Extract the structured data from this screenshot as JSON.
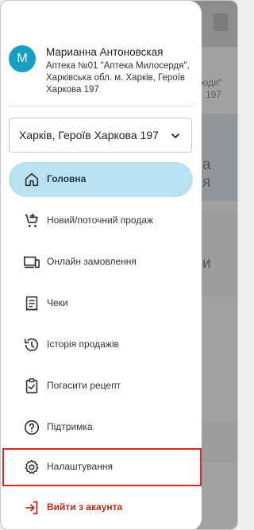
{
  "background": {
    "text_lines": [
      "родя\"",
      "197"
    ],
    "big_letters": [
      "а",
      "я",
      "и"
    ]
  },
  "user": {
    "avatar_letter": "M",
    "name": "Марианна Антоновская",
    "pharmacy": "Аптека  №01  \"Аптека Милосердя\", Харківська обл. м. Харків, Героїв Харкова 197"
  },
  "store_selector": {
    "value": "Харків, Героїв Харкова 197",
    "icon": "chevron-down-icon"
  },
  "menu": {
    "home": {
      "label": "Головна",
      "icon": "home-icon"
    },
    "new_sale": {
      "label": "Новий/поточний продаж",
      "icon": "cart-add-icon"
    },
    "online_orders": {
      "label": "Онлайн замовлення",
      "icon": "devices-icon"
    },
    "receipts": {
      "label": "Чеки",
      "icon": "receipt-icon"
    },
    "sales_history": {
      "label": "Історія продажів",
      "icon": "history-icon"
    },
    "redeem_prescription": {
      "label": "Погасити рецепт",
      "icon": "clipboard-check-icon"
    },
    "support": {
      "label": "Підтримка",
      "icon": "help-circle-icon"
    },
    "settings": {
      "label": "Налаштування",
      "icon": "gear-icon"
    },
    "logout": {
      "label": "Вийти з акаунта",
      "icon": "logout-icon"
    }
  },
  "colors": {
    "accent": "#16a0bd",
    "active_bg": "#b9e1f0",
    "logout": "#c0281c",
    "highlight": "#d62a2a"
  }
}
